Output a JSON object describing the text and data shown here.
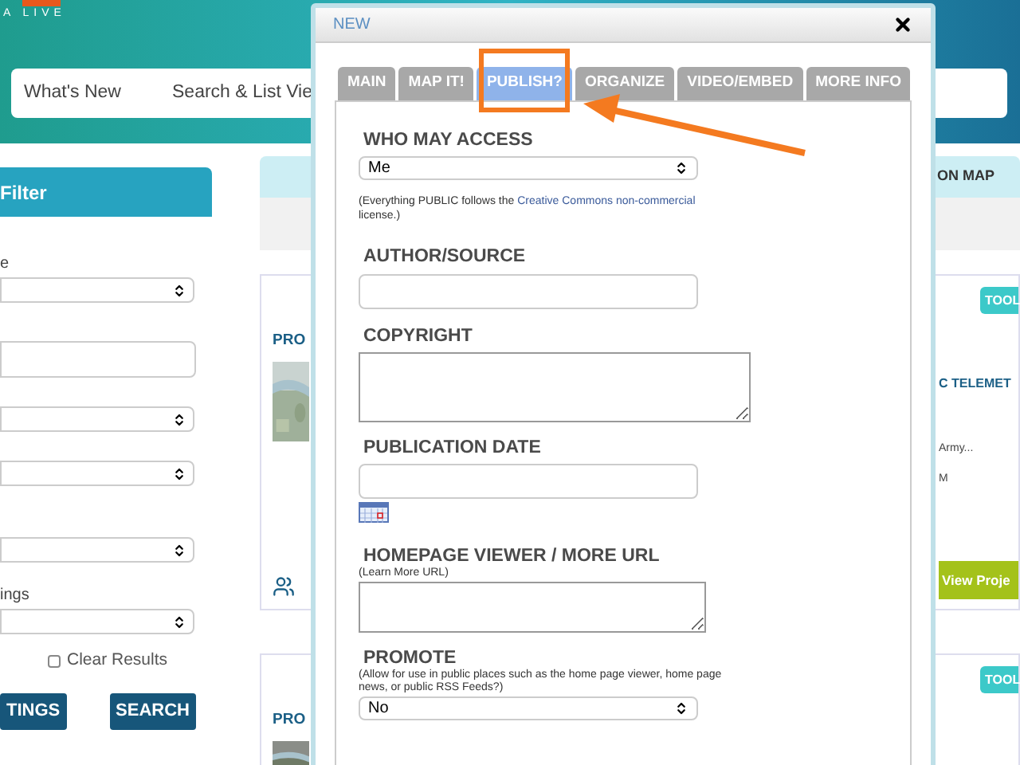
{
  "header": {
    "logo_text": "A LIVE",
    "nav": [
      "What's New",
      "Search & List Vie"
    ]
  },
  "sidebar": {
    "title": "Filter",
    "fields": [
      {
        "kind": "select",
        "label": "e"
      },
      {
        "kind": "input"
      },
      {
        "kind": "select"
      },
      {
        "kind": "select"
      },
      {
        "kind": "select"
      },
      {
        "kind": "select",
        "label": "ings"
      }
    ],
    "clear_results": {
      "label": "Clear Results",
      "checked": false
    },
    "buttons": [
      "TINGS",
      "SEARCH"
    ]
  },
  "results": {
    "header": "ON MAP",
    "cards": [
      {
        "title": "PRO",
        "badge": "TOOL",
        "title_end": "C TELEMET",
        "lines": [
          "Army...",
          "M"
        ],
        "button": "View Proje"
      },
      {
        "title": "PRO",
        "badge": "TOOL"
      }
    ]
  },
  "modal": {
    "title": "NEW",
    "tabs": [
      {
        "label": "MAIN",
        "selected": false
      },
      {
        "label": "MAP IT!",
        "selected": false
      },
      {
        "label": "PUBLISH?",
        "selected": true
      },
      {
        "label": "ORGANIZE",
        "selected": false
      },
      {
        "label": "VIDEO/EMBED",
        "selected": false
      },
      {
        "label": "MORE INFO",
        "selected": false
      }
    ],
    "fields": [
      {
        "kind": "select",
        "label": "WHO MAY ACCESS",
        "value": "Me",
        "note": {
          "before": "(Everything PUBLIC follows the ",
          "link": "Creative Commons non-commercial",
          "after": " license.)"
        }
      },
      {
        "kind": "input",
        "label": "AUTHOR/SOURCE"
      },
      {
        "kind": "textarea",
        "label": "COPYRIGHT"
      },
      {
        "kind": "date",
        "label": "PUBLICATION DATE"
      },
      {
        "kind": "textarea",
        "label": "HOMEPAGE VIEWER / MORE URL",
        "hint": "(Learn More URL)"
      },
      {
        "kind": "select",
        "label": "PROMOTE",
        "hint": "(Allow for use in public places such as the home page viewer, home page news, or public RSS Feeds?)",
        "value": "No"
      }
    ]
  }
}
